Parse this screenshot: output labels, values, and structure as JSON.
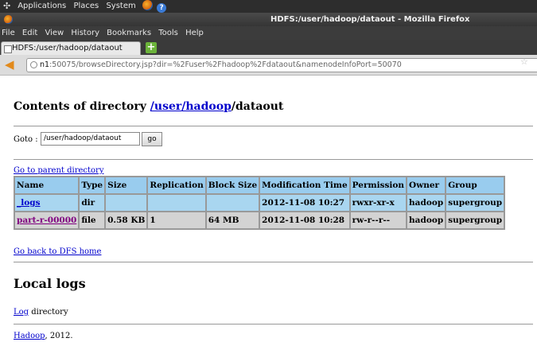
{
  "panel": {
    "applications": "Applications",
    "places": "Places",
    "system": "System"
  },
  "window": {
    "title": "HDFS:/user/hadoop/dataout - Mozilla Firefox"
  },
  "menu": [
    "File",
    "Edit",
    "View",
    "History",
    "Bookmarks",
    "Tools",
    "Help"
  ],
  "tab": {
    "label": "HDFS:/user/hadoop/dataout",
    "new_tab": "+"
  },
  "address": {
    "host": "n1",
    "rest": ":50075/browseDirectory.jsp?dir=%2Fuser%2Fhadoop%2Fdataout&namenodeInfoPort=50070"
  },
  "page": {
    "heading_prefix": "Contents of directory ",
    "heading_user": "/user",
    "heading_hadoop": "/hadoop",
    "heading_tail": "/dataout",
    "goto_label": "Goto : ",
    "goto_value": "/user/hadoop/dataout",
    "go_button": "go",
    "parent_link": "Go to parent directory",
    "dfs_home": "Go back to DFS home",
    "local_logs": "Local logs",
    "log_link": "Log",
    "log_text": " directory",
    "footer_link": "Hadoop",
    "footer_text": ", 2012."
  },
  "table": {
    "headers": [
      "Name",
      "Type",
      "Size",
      "Replication",
      "Block Size",
      "Modification Time",
      "Permission",
      "Owner",
      "Group"
    ],
    "rows": [
      [
        "_logs",
        "dir",
        "",
        "",
        "",
        "2012-11-08 10:27",
        "rwxr-xr-x",
        "hadoop",
        "supergroup"
      ],
      [
        "part-r-00000",
        "file",
        "0.58 KB",
        "1",
        "64 MB",
        "2012-11-08 10:28",
        "rw-r--r--",
        "hadoop",
        "supergroup"
      ]
    ]
  },
  "colors": {
    "header_row": "#99ccee",
    "dir_row": "#a9d6f0",
    "file_row": "#d3d3d3",
    "link": "#0000cc",
    "visited_link": "#800080"
  }
}
